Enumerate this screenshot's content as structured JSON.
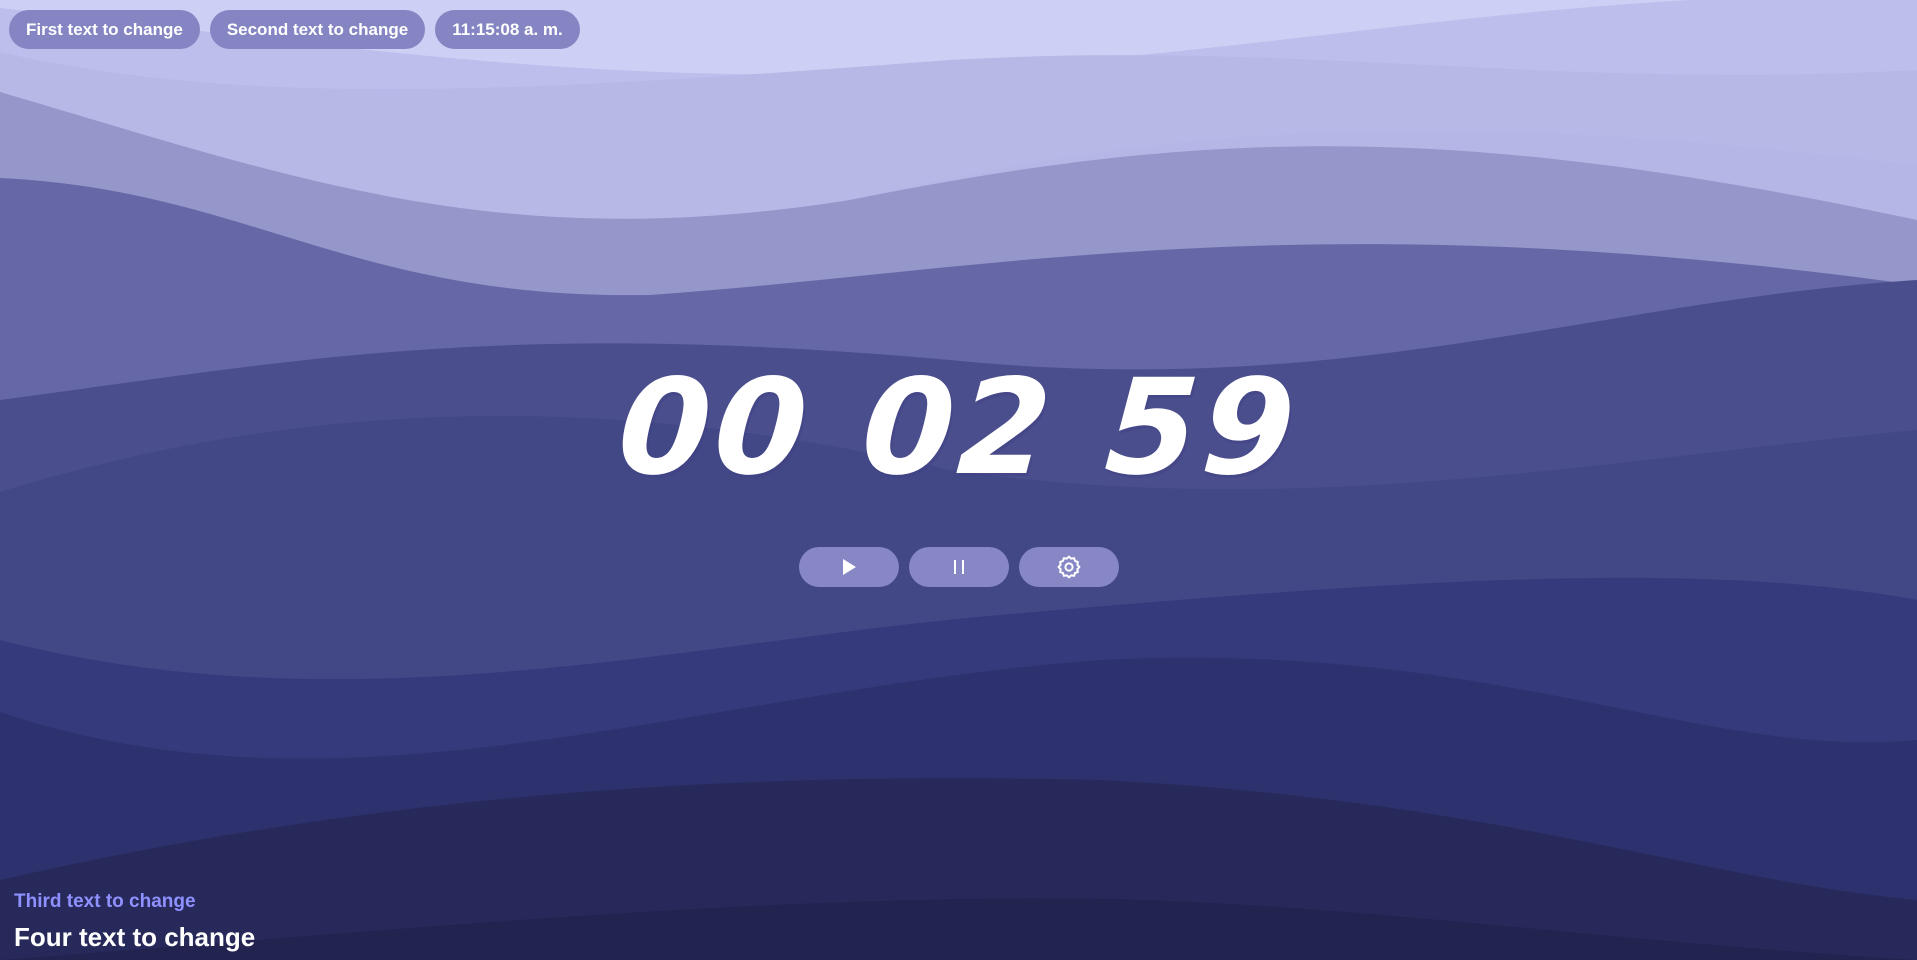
{
  "header": {
    "pills": [
      {
        "label": "First text to change"
      },
      {
        "label": "Second text to change"
      },
      {
        "label": "11:15:08 a. m."
      }
    ]
  },
  "timer": {
    "hours": "00",
    "minutes": "02",
    "seconds": "59"
  },
  "controls": {
    "play_icon": "play-icon",
    "pause_icon": "pause-icon",
    "settings_icon": "gear-icon"
  },
  "footer": {
    "subtitle": "Third text to change",
    "title": "Four text to change"
  },
  "colors": {
    "pill_bg": "#8585c3",
    "subtitle_accent": "#8e91ff",
    "text": "#ffffff"
  }
}
